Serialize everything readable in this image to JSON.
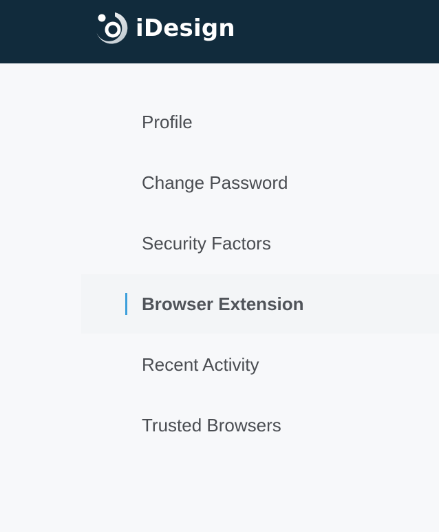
{
  "brand": {
    "name": "iDesign",
    "logo_icon": "idesign-logo-icon",
    "header_color": "#112b3c"
  },
  "nav": {
    "accent_color": "#3d9fdb",
    "items": [
      {
        "label": "Profile",
        "active": false
      },
      {
        "label": "Change Password",
        "active": false
      },
      {
        "label": "Security Factors",
        "active": false
      },
      {
        "label": "Browser Extension",
        "active": true
      },
      {
        "label": "Recent Activity",
        "active": false
      },
      {
        "label": "Trusted Browsers",
        "active": false
      }
    ]
  }
}
